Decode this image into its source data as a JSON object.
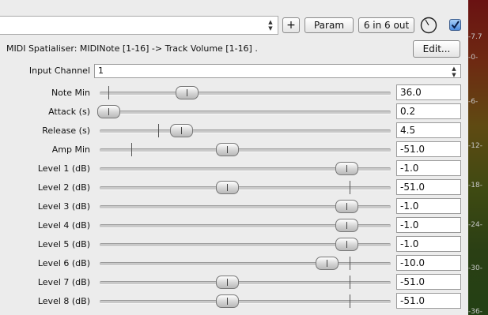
{
  "toolbar": {
    "preset_value": "",
    "add_label": "+",
    "param_label": "Param",
    "io_label": "6 in 6 out",
    "checkbox_checked": true
  },
  "plugin": {
    "description": "MIDI Spatialiser: MIDINote [1-16] -> Track Volume [1-16] .",
    "edit_label": "Edit..."
  },
  "input_channel": {
    "label": "Input Channel",
    "value": "1"
  },
  "params": [
    {
      "label": "Note Min",
      "value": "36.0",
      "level": 0.3,
      "marker": 0.03
    },
    {
      "label": "Attack (s)",
      "value": "0.2",
      "level": 0.03,
      "marker": null
    },
    {
      "label": "Release (s)",
      "value": "4.5",
      "level": 0.28,
      "marker": 0.2
    },
    {
      "label": "Amp Min",
      "value": "-51.0",
      "level": 0.44,
      "marker": 0.11
    },
    {
      "label": "Level 1 (dB)",
      "value": "-1.0",
      "level": 0.85,
      "marker": null
    },
    {
      "label": "Level 2 (dB)",
      "value": "-51.0",
      "level": 0.44,
      "marker": 0.86
    },
    {
      "label": "Level 3 (dB)",
      "value": "-1.0",
      "level": 0.85,
      "marker": 0.86
    },
    {
      "label": "Level 4 (dB)",
      "value": "-1.0",
      "level": 0.85,
      "marker": 0.86
    },
    {
      "label": "Level 5 (dB)",
      "value": "-1.0",
      "level": 0.85,
      "marker": 0.86
    },
    {
      "label": "Level 6 (dB)",
      "value": "-10.0",
      "level": 0.78,
      "marker": 0.86
    },
    {
      "label": "Level 7 (dB)",
      "value": "-51.0",
      "level": 0.44,
      "marker": 0.86
    },
    {
      "label": "Level 8 (dB)",
      "value": "-51.0",
      "level": 0.44,
      "marker": 0.86
    }
  ],
  "meter": {
    "ticks": [
      "-7.7",
      "-0-",
      "-6-",
      "-12-",
      "-18-",
      "-24-",
      "-30-",
      "-36-"
    ]
  },
  "colors": {
    "checkbox_accent": "#4c8de0",
    "meter_top": "#6a1212",
    "meter_bottom": "#234014"
  }
}
